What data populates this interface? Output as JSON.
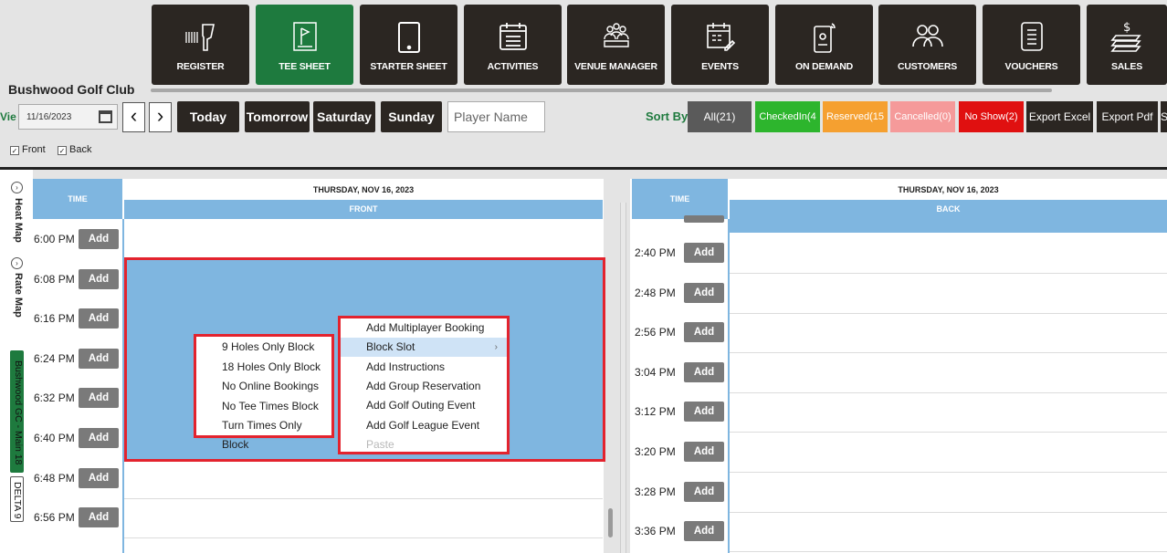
{
  "nav": [
    {
      "key": "register",
      "label": "REGISTER",
      "icon": "barcode-scanner-icon",
      "active": false
    },
    {
      "key": "tee_sheet",
      "label": "TEE SHEET",
      "icon": "flag-icon",
      "active": true
    },
    {
      "key": "starter_sheet",
      "label": "STARTER SHEET",
      "icon": "tablet-icon",
      "active": false
    },
    {
      "key": "activities",
      "label": "ACTIVITIES",
      "icon": "calendar-list-icon",
      "active": false
    },
    {
      "key": "venue_manager",
      "label": "VENUE MANAGER",
      "icon": "people-meeting-icon",
      "active": false
    },
    {
      "key": "events",
      "label": "EVENTS",
      "icon": "calendar-edit-icon",
      "active": false
    },
    {
      "key": "on_demand",
      "label": "ON DEMAND",
      "icon": "mobile-signal-icon",
      "active": false
    },
    {
      "key": "customers",
      "label": "CUSTOMERS",
      "icon": "group-icon",
      "active": false
    },
    {
      "key": "vouchers",
      "label": "VOUCHERS",
      "icon": "document-icon",
      "active": false
    },
    {
      "key": "sales",
      "label": "SALES",
      "icon": "money-stack-icon",
      "active": false
    }
  ],
  "club_name": "Bushwood Golf Club",
  "toolbar": {
    "view_label": "Vie",
    "date": "11/16/2023",
    "prev": "‹",
    "next": "›",
    "today": "Today",
    "tomorrow": "Tomorrow",
    "saturday": "Saturday",
    "sunday": "Sunday",
    "player_placeholder": "Player Name",
    "sort_by": "Sort By",
    "filters": {
      "all": "All(21)",
      "checked_in": "CheckedIn(4",
      "reserved": "Reserved(15",
      "cancelled": "Cancelled(0)",
      "no_show": "No Show(2)",
      "export_excel": "Export Excel",
      "export_pdf": "Export Pdf",
      "more": "S"
    },
    "front": "Front",
    "back": "Back"
  },
  "colors": {
    "dark": "#2b2622",
    "active_green": "#1e7a3e",
    "all": "#5a5a5a",
    "checked_in": "#2db52d",
    "reserved": "#f5a030",
    "cancelled": "#f59a9a",
    "no_show": "#e01010",
    "header_blue": "#7fb6e0",
    "highlight_red": "#e3232e"
  },
  "rail": {
    "heat_map": "Heat Map",
    "rate_map": "Rate Map",
    "course": "Bushwood GC - Main 18",
    "delta": "DELTA 9"
  },
  "front": {
    "time_header": "TIME",
    "date_header": "THURSDAY, NOV 16, 2023",
    "section": "FRONT",
    "rows": [
      {
        "time": "6:00 PM"
      },
      {
        "time": "6:08 PM"
      },
      {
        "time": "6:16 PM"
      },
      {
        "time": "6:24 PM"
      },
      {
        "time": "6:32 PM"
      },
      {
        "time": "6:40 PM"
      },
      {
        "time": "6:48 PM"
      },
      {
        "time": "6:56 PM"
      }
    ]
  },
  "back": {
    "time_header": "TIME",
    "date_header": "THURSDAY, NOV 16, 2023",
    "section": "BACK",
    "rows": [
      {
        "time": "2:40 PM"
      },
      {
        "time": "2:48 PM"
      },
      {
        "time": "2:56 PM"
      },
      {
        "time": "3:04 PM"
      },
      {
        "time": "3:12 PM"
      },
      {
        "time": "3:20 PM"
      },
      {
        "time": "3:28 PM"
      },
      {
        "time": "3:36 PM"
      }
    ]
  },
  "add_label": "Add",
  "context_menu": [
    {
      "label": "Add Multiplayer Booking"
    },
    {
      "label": "Block Slot",
      "submenu": true,
      "highlighted": true
    },
    {
      "label": "Add Instructions"
    },
    {
      "label": "Add Group Reservation"
    },
    {
      "label": "Add Golf Outing Event"
    },
    {
      "label": "Add Golf League Event"
    },
    {
      "label": "Paste",
      "disabled": true
    }
  ],
  "block_submenu": [
    {
      "label": "9 Holes Only Block"
    },
    {
      "label": "18 Holes Only Block"
    },
    {
      "label": "No Online Bookings"
    },
    {
      "label": "No Tee Times Block"
    },
    {
      "label": "Turn Times Only Block"
    }
  ]
}
